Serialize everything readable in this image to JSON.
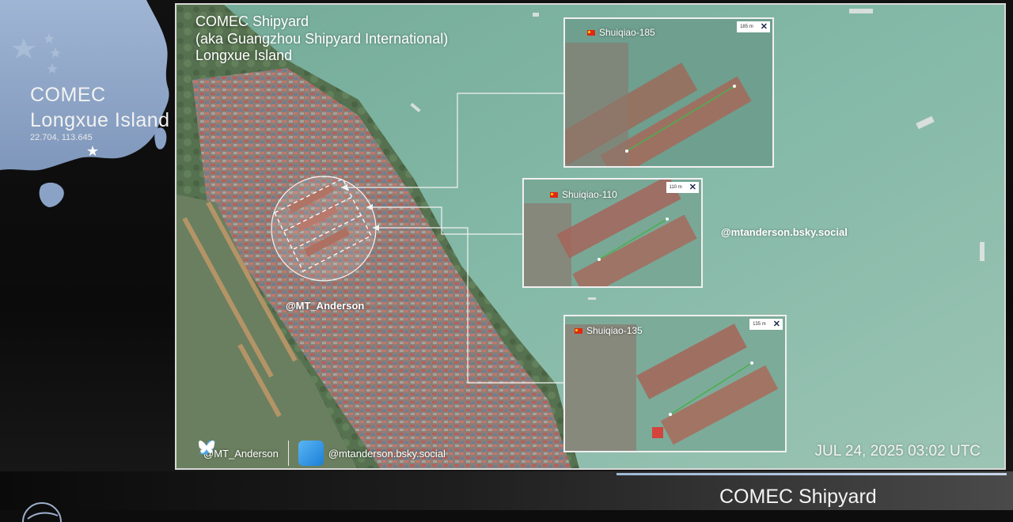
{
  "inset": {
    "title_line1": "COMEC",
    "title_line2": "Longxue Island",
    "coords": "22.704, 113.645",
    "marker_icon": "star-icon"
  },
  "main_map": {
    "title_line1": "COMEC Shipyard",
    "title_line2": "(aka Guangzhou Shipyard International)",
    "title_line3": "Longxue Island",
    "handle_center": "@MT_Anderson",
    "handle_right": "@mtanderson.bsky.social",
    "timestamp": "JUL 24, 2025 03:02 UTC",
    "social": {
      "twitter_icon": "twitter-icon",
      "twitter_handle": "@MT_Anderson",
      "bluesky_icon": "bluesky-icon",
      "bluesky_handle": "@mtanderson.bsky.social"
    }
  },
  "panels": [
    {
      "name": "Shuiqiao-185",
      "flag": "china-flag-icon",
      "scale": "185 m",
      "close_icon": "close-icon"
    },
    {
      "name": "Shuiqiao-110",
      "flag": "china-flag-icon",
      "scale": "110 m",
      "close_icon": "close-icon"
    },
    {
      "name": "Shuiqiao-135",
      "flag": "china-flag-icon",
      "scale": "135 m",
      "close_icon": "close-icon"
    }
  ],
  "footer": {
    "title": "COMEC Shipyard"
  },
  "colors": {
    "water": "#7fb3a2",
    "measure_line": "#4caf50",
    "flag_red": "#de2910",
    "accent_line": "#b3c8e2"
  }
}
